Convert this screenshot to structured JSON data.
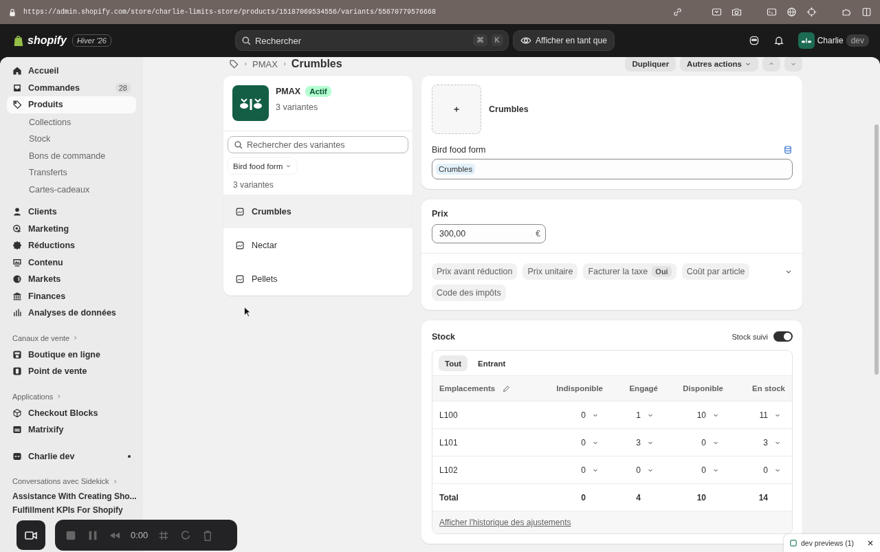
{
  "browser": {
    "url": "https://admin.shopify.com/store/charlie-limits-store/products/15187069534556/variants/55670779576668"
  },
  "topbar": {
    "logo": "shopify",
    "edition": "Hiver '26",
    "search": {
      "placeholder": "Rechercher",
      "keys": [
        "⌘",
        "K"
      ]
    },
    "view_as": "Afficher en tant que",
    "user": {
      "name": "Charlie",
      "badge": "dev"
    }
  },
  "sidebar": {
    "nav": [
      {
        "label": "Accueil",
        "selected": false
      },
      {
        "label": "Commandes",
        "badge": "28",
        "selected": false
      },
      {
        "label": "Produits",
        "selected": true,
        "children": [
          {
            "label": "Collections",
            "selected": false
          },
          {
            "label": "Stock",
            "selected": false
          },
          {
            "label": "Bons de commande",
            "selected": false
          },
          {
            "label": "Transferts",
            "selected": false
          },
          {
            "label": "Cartes-cadeaux",
            "selected": false
          }
        ]
      },
      {
        "label": "Clients",
        "selected": false
      },
      {
        "label": "Marketing",
        "selected": false
      },
      {
        "label": "Réductions",
        "selected": false
      },
      {
        "label": "Contenu",
        "selected": false
      },
      {
        "label": "Markets",
        "selected": false
      },
      {
        "label": "Finances",
        "selected": false
      },
      {
        "label": "Analyses de données",
        "selected": false
      }
    ],
    "sections": [
      {
        "title": "Canaux de vente",
        "items": [
          {
            "label": "Boutique en ligne",
            "selected": false
          },
          {
            "label": "Point de vente",
            "selected": false
          }
        ]
      },
      {
        "title": "Applications",
        "items": [
          {
            "label": "Checkout Blocks",
            "selected": false
          },
          {
            "label": "Matrixify",
            "selected": false
          }
        ]
      }
    ],
    "pinned": [
      {
        "label": "Charlie dev",
        "unread": true
      }
    ],
    "sidekick": {
      "title": "Conversations avec Sidekick",
      "items": [
        "Assistance With Creating Sho...",
        "Fulfillment KPIs For Shopify"
      ]
    }
  },
  "page": {
    "breadcrumb": [
      "PMAX"
    ],
    "title": "Crumbles",
    "actions": [
      {
        "label": "Dupliquer",
        "menu": false
      },
      {
        "label": "Autres actions",
        "menu": true
      }
    ]
  },
  "product": {
    "name": "PMAX",
    "status": "Actif",
    "variant_count": "3 variantes",
    "search": {
      "placeholder": "Rechercher des variantes"
    },
    "filter": "Bird food form",
    "list_count": "3 variantes",
    "variants": [
      {
        "name": "Crumbles",
        "selected": true
      },
      {
        "name": "Nectar",
        "selected": false
      },
      {
        "name": "Pellets",
        "selected": false
      }
    ]
  },
  "variant": {
    "name": "Crumbles",
    "option": {
      "label": "Bird food form",
      "values": [
        "Crumbles"
      ]
    }
  },
  "price": {
    "title": "Prix",
    "value": "300,00",
    "currency": "€",
    "extras": [
      {
        "label": "Prix avant réduction"
      },
      {
        "label": "Prix unitaire"
      },
      {
        "label": "Facturer la taxe",
        "value": "Oui"
      },
      {
        "label": "Coût par article"
      },
      {
        "label": "Code des impôts"
      }
    ]
  },
  "stock": {
    "title": "Stock",
    "tracking": {
      "label": "Stock suivi",
      "on": true
    },
    "tabs": [
      {
        "label": "Tout",
        "selected": true
      },
      {
        "label": "Entrant",
        "selected": false
      }
    ],
    "columns": [
      "Emplacements",
      "Indisponible",
      "Engagé",
      "Disponible",
      "En stock"
    ],
    "rows": [
      {
        "location": "L100",
        "values": [
          "0",
          "1",
          "10",
          "11"
        ]
      },
      {
        "location": "L101",
        "values": [
          "0",
          "3",
          "0",
          "3"
        ]
      },
      {
        "location": "L102",
        "values": [
          "0",
          "0",
          "0",
          "0"
        ]
      }
    ],
    "total": {
      "label": "Total",
      "values": [
        "0",
        "4",
        "10",
        "14"
      ]
    },
    "history_link": "Afficher l'historique des ajustements"
  },
  "recorder": {
    "time": "0:00"
  },
  "dev_previews": {
    "label": "dev previews (1)"
  }
}
